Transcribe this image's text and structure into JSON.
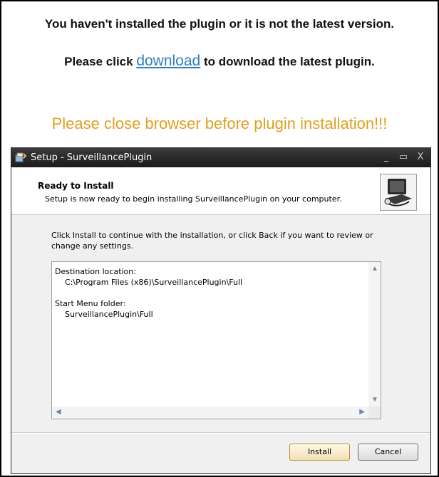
{
  "page": {
    "message_line1": "You haven't installed the plugin or it is not the latest version.",
    "message_line2_prefix": "Please click",
    "download_link": "download",
    "message_line2_suffix": "to download the latest plugin.",
    "warning": "Please close browser before plugin installation!!!"
  },
  "installer": {
    "window_title": "Setup - SurveillancePlugin",
    "controls": {
      "minimize": "_",
      "maximize": "▭",
      "close": "X"
    },
    "header_title": "Ready to Install",
    "header_subtitle": "Setup is now ready to begin installing SurveillancePlugin on your computer.",
    "instructions": "Click Install to continue with the installation, or click Back if you want to review or change any settings.",
    "memo": {
      "destination_label": "Destination location:",
      "destination_value": "C:\\Program Files (x86)\\SurveillancePlugin\\Full",
      "start_menu_label": "Start Menu folder:",
      "start_menu_value": "SurveillancePlugin\\Full"
    },
    "buttons": {
      "install": "Install",
      "cancel": "Cancel"
    }
  },
  "colors": {
    "link": "#2f7fc0",
    "warning": "#e0a020",
    "titlebar": "#1c1c1c"
  }
}
